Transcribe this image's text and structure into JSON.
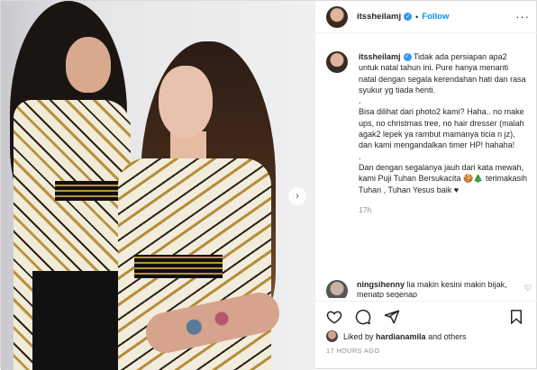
{
  "post": {
    "username": "itssheilamj",
    "follow_label": "Follow",
    "separator": "•",
    "more_icon": "more-horizontal-icon",
    "caption_username": "itssheilamj",
    "caption": "Tidak ada persiapan apa2 untuk natal tahun ini. Pure hanya menanti natal dengan segala kerendahan hati dan rasa syukur yg tiada henti.\n.\nBisa dilihat dari photo2 kami? Haha.. no make ups, no christmas tree, no hair dresser (malah agak2 lepek ya rambut mamanya ticia n jz), dan kami mengandalkan timer HP! hahaha!\n.\nDan dengan segalanya jauh dari kata mewah, kami Puji Tuhan Bersukacita 🍪🎄 terimakasih Tuhan , Tuhan Yesus baik ♥",
    "caption_age": "17h",
    "comment": {
      "username": "ningsihenny",
      "text": "lia makin kesini makin bijak, menatp segenap"
    },
    "liked_by_prefix": "Liked by",
    "liked_by_user": "hardianamila",
    "liked_by_suffix": "and others",
    "time_ago": "17 HOURS AGO"
  },
  "colors": {
    "accent": "#0095f6",
    "verified": "#3897f0",
    "muted": "#8e8e8e",
    "text": "#262626"
  }
}
